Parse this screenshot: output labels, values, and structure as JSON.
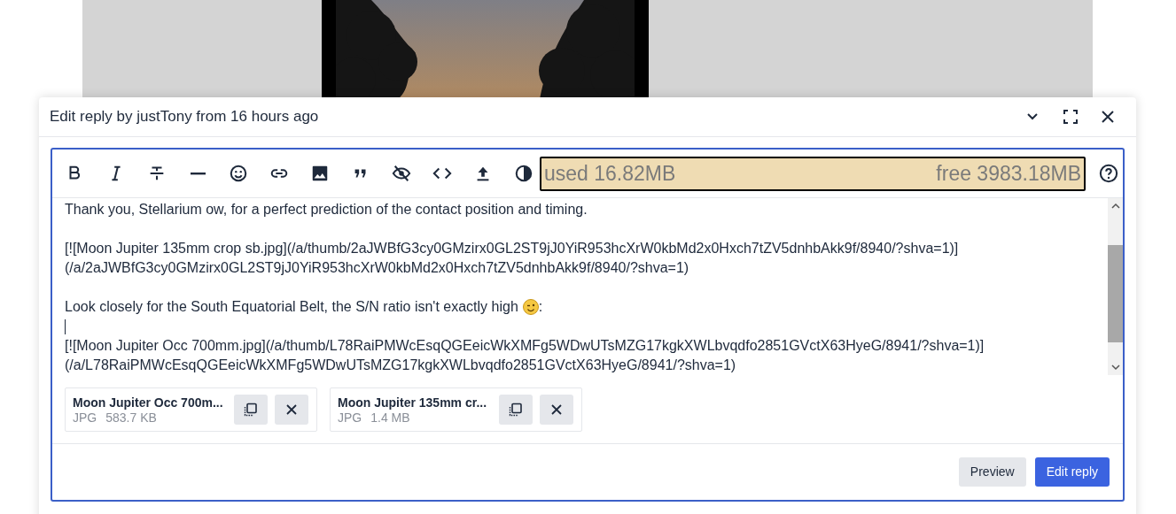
{
  "dialog": {
    "title": "Edit reply by justTony from 16 hours ago"
  },
  "storage": {
    "used": "used 16.82MB",
    "free": "free 3983.18MB"
  },
  "editor_lines": [
    {
      "kind": "text",
      "text": "Thank you, Stellarium ow, for a perfect prediction of the contact position and timing."
    },
    {
      "kind": "blank"
    },
    {
      "kind": "text",
      "text": "[![Moon Jupiter 135mm crop sb.jpg](/a/thumb/2aJWBfG3cy0GMzirx0GL2ST9jJ0YiR953hcXrW0kbMd2x0Hxch7tZV5dnhbAkk9f/8940/?shva=1)]"
    },
    {
      "kind": "text",
      "text": "(/a/2aJWBfG3cy0GMzirx0GL2ST9jJ0YiR953hcXrW0kbMd2x0Hxch7tZV5dnhbAkk9f/8940/?shva=1)"
    },
    {
      "kind": "blank"
    },
    {
      "kind": "emoji",
      "text": "Look closely for the South Equatorial Belt, the S/N ratio isn't exactly high",
      "after": ":"
    },
    {
      "kind": "caret"
    },
    {
      "kind": "text",
      "text": "[![Moon Jupiter Occ 700mm.jpg](/a/thumb/L78RaiPMWcEsqQGEeicWkXMFg5WDwUTsMZG17kgkXWLbvqdfo2851GVctX63HyeG/8941/?shva=1)]"
    },
    {
      "kind": "text",
      "text": "(/a/L78RaiPMWcEsqQGEeicWkXMFg5WDwUTsMZG17kgkXWLbvqdfo2851GVctX63HyeG/8941/?shva=1)"
    }
  ],
  "attachments": [
    {
      "name": "Moon Jupiter Occ 700m...",
      "type": "JPG",
      "size": "583.7 KB"
    },
    {
      "name": "Moon Jupiter 135mm cr...",
      "type": "JPG",
      "size": "1.4 MB"
    }
  ],
  "buttons": {
    "preview": "Preview",
    "submit": "Edit reply"
  }
}
